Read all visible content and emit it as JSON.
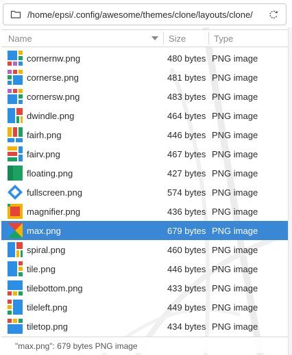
{
  "location": {
    "path": "/home/epsi/.config/awesome/themes/clone/layouts/clone/"
  },
  "columns": {
    "name": "Name",
    "size": "Size",
    "type": "Type"
  },
  "colors": {
    "selection": "#3a87d6",
    "icon_blue": "#2b8fe8",
    "icon_red": "#e8433b",
    "icon_yellow": "#f4b400",
    "icon_green": "#1aa260",
    "icon_purple": "#b565c6"
  },
  "files": [
    {
      "name": "cornernw.png",
      "size": "480 bytes",
      "type": "PNG image",
      "icon": "cornernw-layout-icon"
    },
    {
      "name": "cornerse.png",
      "size": "481 bytes",
      "type": "PNG image",
      "icon": "cornerse-layout-icon"
    },
    {
      "name": "cornersw.png",
      "size": "483 bytes",
      "type": "PNG image",
      "icon": "cornersw-layout-icon"
    },
    {
      "name": "dwindle.png",
      "size": "464 bytes",
      "type": "PNG image",
      "icon": "dwindle-layout-icon"
    },
    {
      "name": "fairh.png",
      "size": "446 bytes",
      "type": "PNG image",
      "icon": "fairh-layout-icon"
    },
    {
      "name": "fairv.png",
      "size": "467 bytes",
      "type": "PNG image",
      "icon": "fairv-layout-icon"
    },
    {
      "name": "floating.png",
      "size": "427 bytes",
      "type": "PNG image",
      "icon": "floating-layout-icon"
    },
    {
      "name": "fullscreen.png",
      "size": "574 bytes",
      "type": "PNG image",
      "icon": "fullscreen-layout-icon"
    },
    {
      "name": "magnifier.png",
      "size": "436 bytes",
      "type": "PNG image",
      "icon": "magnifier-layout-icon"
    },
    {
      "name": "max.png",
      "size": "679 bytes",
      "type": "PNG image",
      "icon": "max-layout-icon",
      "selected": true
    },
    {
      "name": "spiral.png",
      "size": "460 bytes",
      "type": "PNG image",
      "icon": "spiral-layout-icon"
    },
    {
      "name": "tile.png",
      "size": "446 bytes",
      "type": "PNG image",
      "icon": "tile-layout-icon"
    },
    {
      "name": "tilebottom.png",
      "size": "433 bytes",
      "type": "PNG image",
      "icon": "tilebottom-layout-icon"
    },
    {
      "name": "tileleft.png",
      "size": "449 bytes",
      "type": "PNG image",
      "icon": "tileleft-layout-icon"
    },
    {
      "name": "tiletop.png",
      "size": "434 bytes",
      "type": "PNG image",
      "icon": "tiletop-layout-icon"
    }
  ],
  "status": {
    "text": "\"max.png\": 679 bytes PNG image"
  }
}
